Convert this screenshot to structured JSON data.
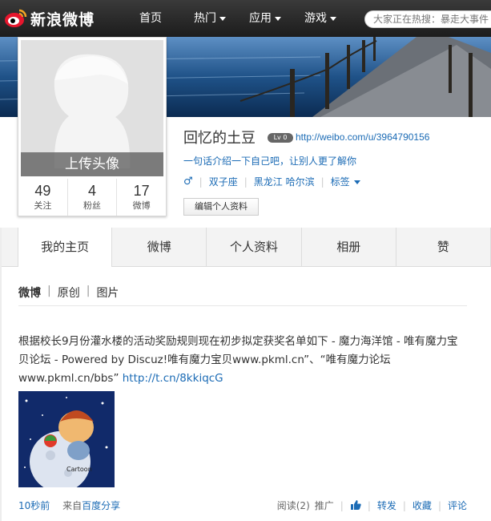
{
  "nav": {
    "logo_text": "新浪微博",
    "items": [
      {
        "label": "首页",
        "has_caret": false
      },
      {
        "label": "热门",
        "has_caret": true
      },
      {
        "label": "应用",
        "has_caret": true
      },
      {
        "label": "游戏",
        "has_caret": true
      }
    ],
    "search_placeholder": "大家正在热搜：暴走大事件"
  },
  "profile": {
    "upload_avatar": "上传头像",
    "stats": [
      {
        "num": "49",
        "label": "关注"
      },
      {
        "num": "4",
        "label": "粉丝"
      },
      {
        "num": "17",
        "label": "微博"
      }
    ],
    "name": "回忆的土豆",
    "level_badge": "Lv 0",
    "url": "http://weibo.com/u/3964790156",
    "intro": "一句话介绍一下自己吧，让别人更了解你",
    "gender_icon": "male-icon",
    "constellation": "双子座",
    "location": "黑龙江 哈尔滨",
    "tags_label": "标签",
    "edit_button": "编辑个人资料"
  },
  "tabs": [
    "我的主页",
    "微博",
    "个人资料",
    "相册",
    "赞"
  ],
  "feed": {
    "subtabs": [
      "微博",
      "原创",
      "图片"
    ],
    "post": {
      "text": "根据校长9月份灌水楼的活动奖励规则现在初步拟定获奖名单如下 - 魔力海洋馆 - 唯有魔力宝贝论坛 - Powered by Discuz!唯有魔力宝贝www.pkml.cn”、“唯有魔力论坛www.pkml.cn/bbs” ",
      "link": "http://t.cn/8kkiqcG",
      "time": "10秒前",
      "source_prefix": "来自",
      "source": "百度分享",
      "read": "阅读(2)",
      "promote": "推广",
      "like_icon": "thumbs-up-icon",
      "forward": "转发",
      "favorite": "收藏",
      "comment": "评论"
    }
  },
  "colors": {
    "link": "#1b6bb5",
    "nav_bg": "#2a2a2a",
    "tab_bg": "#f3f3f3"
  }
}
